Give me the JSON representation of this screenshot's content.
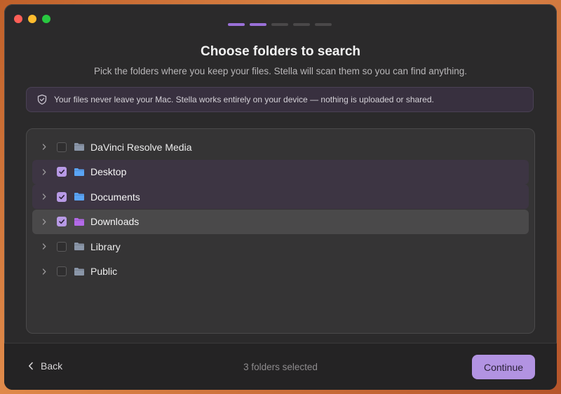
{
  "header": {
    "title": "Choose folders to search",
    "subtitle": "Pick the folders where you keep your files. Stella will scan them so you can find anything.",
    "step_current": 2,
    "step_total": 5
  },
  "notice": {
    "icon": "shield-check-icon",
    "text": "Your files never leave your Mac. Stella works entirely on your device — nothing is uploaded or shared."
  },
  "folders": [
    {
      "name": "DaVinci Resolve Media",
      "checked": false,
      "color": "#8a96a8"
    },
    {
      "name": "Desktop",
      "checked": true,
      "color": "#5aa4f5"
    },
    {
      "name": "Documents",
      "checked": true,
      "color": "#5aa4f5"
    },
    {
      "name": "Downloads",
      "checked": true,
      "color": "#b36ae8"
    },
    {
      "name": "Library",
      "checked": false,
      "color": "#8a96a8"
    },
    {
      "name": "Public",
      "checked": false,
      "color": "#8a96a8"
    }
  ],
  "footer": {
    "back_label": "Back",
    "selected_text": "3 folders selected",
    "continue_label": "Continue"
  },
  "colors": {
    "accent": "#b293e2",
    "checked_row": "#3d3543",
    "hover_row": "#4a494a"
  }
}
